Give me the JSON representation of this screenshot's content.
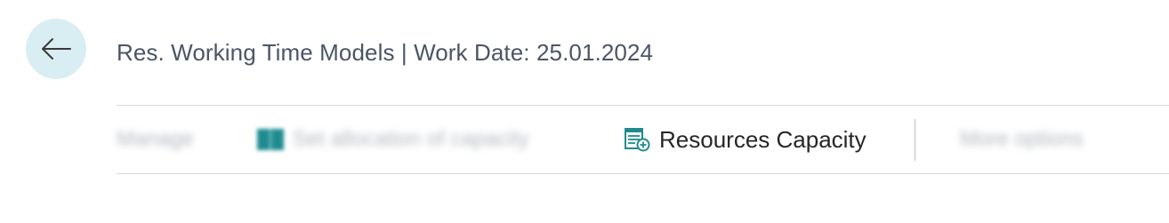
{
  "header": {
    "back_icon": "arrow-left-icon",
    "title": "Res. Working Time Models | Work Date: 25.01.2024"
  },
  "action_bar": {
    "manage_label": "Manage",
    "adjust_label": "Set allocation of capacity",
    "resources_capacity_label": "Resources Capacity",
    "resources_capacity_icon": "calendar-list-icon",
    "more_label": "More options"
  },
  "colors": {
    "back_button_bg": "#d9eef2",
    "title_text": "#4b5565",
    "icon_teal": "#1f8b8e"
  }
}
